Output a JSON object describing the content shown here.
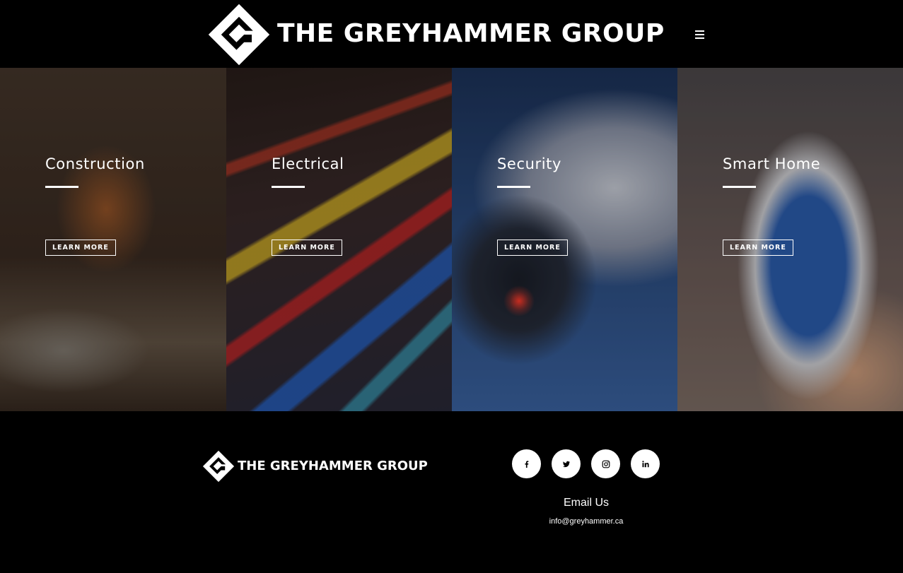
{
  "header": {
    "brand": "THE GREYHAMMER GROUP",
    "logo_icon": "diamond-hammer-logo-icon",
    "menu_icon": "hamburger-menu-icon"
  },
  "panels": [
    {
      "title": "Construction",
      "cta": "LEARN MORE",
      "tint": "#5a4030"
    },
    {
      "title": "Electrical",
      "cta": "LEARN MORE",
      "tint": "#3a3a5a"
    },
    {
      "title": "Security",
      "cta": "LEARN MORE",
      "tint": "#2a4a78"
    },
    {
      "title": "Smart Home",
      "cta": "LEARN MORE",
      "tint": "#5e4e48"
    }
  ],
  "footer": {
    "brand": "THE GREYHAMMER GROUP",
    "social": [
      "facebook-icon",
      "twitter-icon",
      "instagram-icon",
      "linkedin-icon"
    ],
    "email_heading": "Email Us",
    "email": "info@greyhammer.ca"
  },
  "colors": {
    "background": "#000000",
    "text": "#ffffff"
  }
}
